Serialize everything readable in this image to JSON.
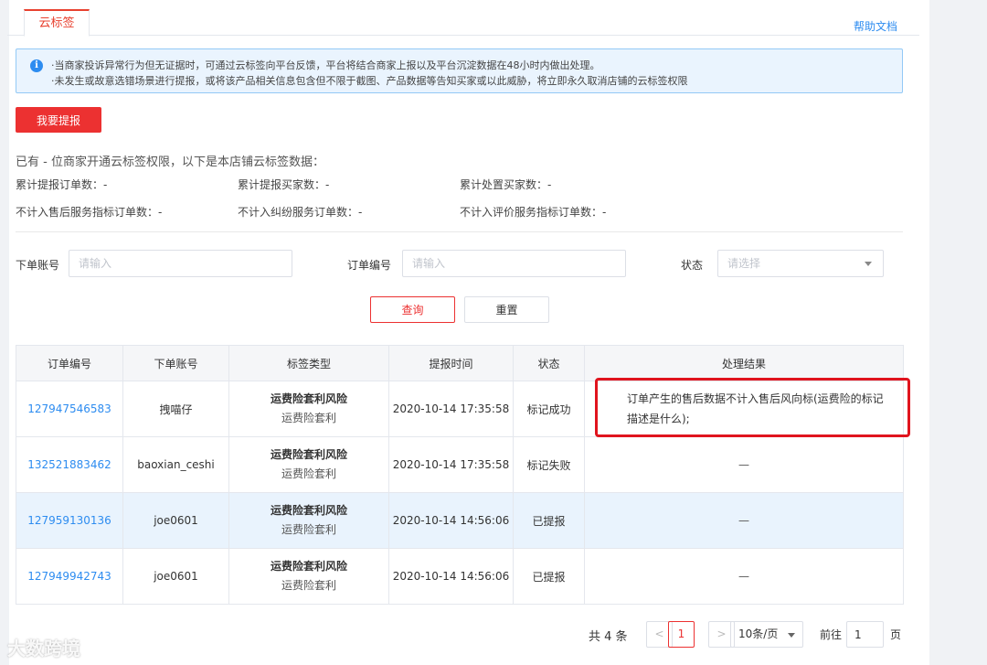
{
  "tabs": {
    "active": "云标签",
    "help": "帮助文档"
  },
  "alert": {
    "line1": "·当商家投诉异常行为但无证据时，可通过云标签向平台反馈，平台将结合商家上报以及平台沉淀数据在48小时内做出处理。",
    "line2": "·未发生或故意选错场景进行提报，或将该产品相关信息包含但不限于截图、产品数据等告知买家或以此威胁，将立即永久取消店铺的云标签权限"
  },
  "report_button": "我要提报",
  "stats": {
    "title": "已有 - 位商家开通云标签权限，以下是本店铺云标签数据：",
    "items": [
      "累计提报订单数：-",
      "累计提报买家数：-",
      "累计处置买家数：-",
      "不计入售后服务指标订单数：-",
      "不计入纠纷服务订单数：-",
      "不计入评价服务指标订单数：-"
    ]
  },
  "filters": {
    "account_label": "下单账号",
    "account_placeholder": "请输入",
    "order_label": "订单编号",
    "order_placeholder": "请输入",
    "status_label": "状态",
    "status_placeholder": "请选择"
  },
  "buttons": {
    "query": "查询",
    "reset": "重置"
  },
  "table": {
    "headers": [
      "订单编号",
      "下单账号",
      "标签类型",
      "提报时间",
      "状态",
      "处理结果"
    ],
    "rows": [
      {
        "order": "127947546583",
        "account": "拽喵仔",
        "tag_main": "运费险套利风险",
        "tag_sub": "运费险套利",
        "time": "2020-10-14 17:35:58",
        "status": "标记成功",
        "result": "订单产生的售后数据不计入售后风向标(运费险的标记描述是什么);"
      },
      {
        "order": "132521883462",
        "account": "baoxian_ceshi",
        "tag_main": "运费险套利风险",
        "tag_sub": "运费险套利",
        "time": "2020-10-14 17:35:58",
        "status": "标记失败",
        "result": "—"
      },
      {
        "order": "127959130136",
        "account": "joe0601",
        "tag_main": "运费险套利风险",
        "tag_sub": "运费险套利",
        "time": "2020-10-14 14:56:06",
        "status": "已提报",
        "result": "—"
      },
      {
        "order": "127949942743",
        "account": "joe0601",
        "tag_main": "运费险套利风险",
        "tag_sub": "运费险套利",
        "time": "2020-10-14 14:56:06",
        "status": "已提报",
        "result": "—"
      }
    ]
  },
  "pagination": {
    "total": "共 4 条",
    "prev": "<",
    "current": "1",
    "next": ">",
    "page_size": "10条/页",
    "goto_label": "前往",
    "goto_value": "1",
    "unit": "页"
  },
  "watermark": "大数跨境"
}
